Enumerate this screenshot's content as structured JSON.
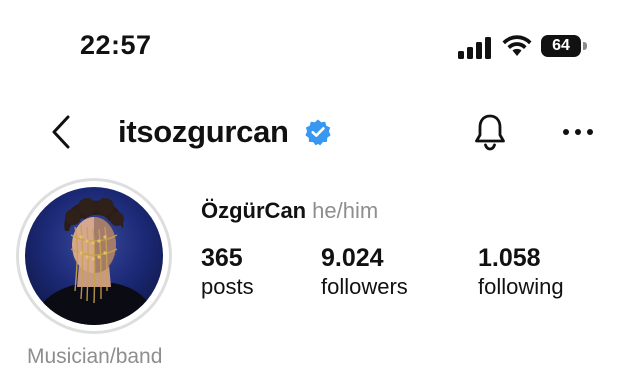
{
  "status_bar": {
    "time": "22:57",
    "battery": "64",
    "signal_icon": "cellular-signal-icon",
    "wifi_icon": "wifi-icon"
  },
  "header": {
    "username": "itsozgurcan",
    "verified": true,
    "back_icon": "chevron-left-icon",
    "bell_icon": "bell-icon",
    "more_icon": "ellipsis-icon",
    "verified_color": "#3897f0"
  },
  "profile": {
    "display_name": "ÖzgürCan",
    "pronouns": "he/him",
    "category": "Musician/band",
    "stats": [
      {
        "value": "365",
        "label": "posts"
      },
      {
        "value": "9.024",
        "label": "followers"
      },
      {
        "value": "1.058",
        "label": "following"
      }
    ]
  }
}
